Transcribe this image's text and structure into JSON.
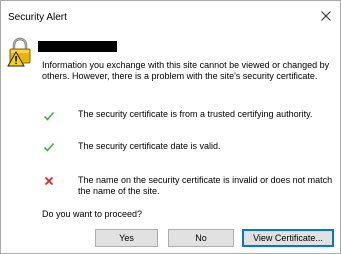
{
  "window": {
    "title": "Security Alert",
    "close_icon": "close-icon"
  },
  "header": {
    "icon": "warning-lock-icon",
    "redacted_site_name": ""
  },
  "message": {
    "info": "Information you exchange with this site cannot be viewed or changed by others. However, there is a problem with the site's security certificate."
  },
  "checks": [
    {
      "status": "ok",
      "icon": "checkmark-icon",
      "color": "#3cb044",
      "text": "The security certificate is from a trusted certifying authority."
    },
    {
      "status": "ok",
      "icon": "checkmark-icon",
      "color": "#3cb044",
      "text": "The security certificate date is valid."
    },
    {
      "status": "error",
      "icon": "error-x-icon",
      "color": "#e0242b",
      "text": "The name on the security certificate is invalid or does not match the name of the site."
    }
  ],
  "question": "Do you want to proceed?",
  "buttons": {
    "yes": "Yes",
    "no": "No",
    "view_certificate": "View Certificate..."
  },
  "colors": {
    "button_bg": "#e1e1e1",
    "button_border": "#adadad",
    "default_button_border": "#0078d7",
    "warning_yellow": "#f7d40a"
  }
}
